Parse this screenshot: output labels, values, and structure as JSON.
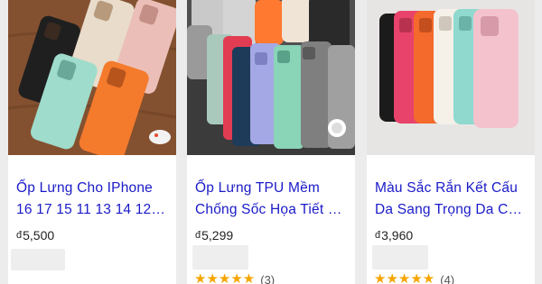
{
  "products": [
    {
      "title_line1": "Ốp Lưng Cho IPhone",
      "title_line2": "16 17 15 11 13 14 12…",
      "currency": "đ",
      "price": "5,500",
      "rating_count": ""
    },
    {
      "title_line1": "Ốp Lưng TPU Mềm",
      "title_line2": "Chống Sốc Họa Tiết …",
      "currency": "đ",
      "price": "5,299",
      "stars": "★★★★★",
      "rating_count": "(3)"
    },
    {
      "title_line1": "Màu Sắc Rắn Kết Cấu",
      "title_line2": "Da Sang Trọng Da C…",
      "currency": "đ",
      "price": "3,960",
      "stars": "★★★★★",
      "rating_count": "(4)"
    }
  ],
  "colors": {
    "title_link": "#1a1ac8",
    "star": "#f6a500",
    "page_background": "#ececec"
  }
}
